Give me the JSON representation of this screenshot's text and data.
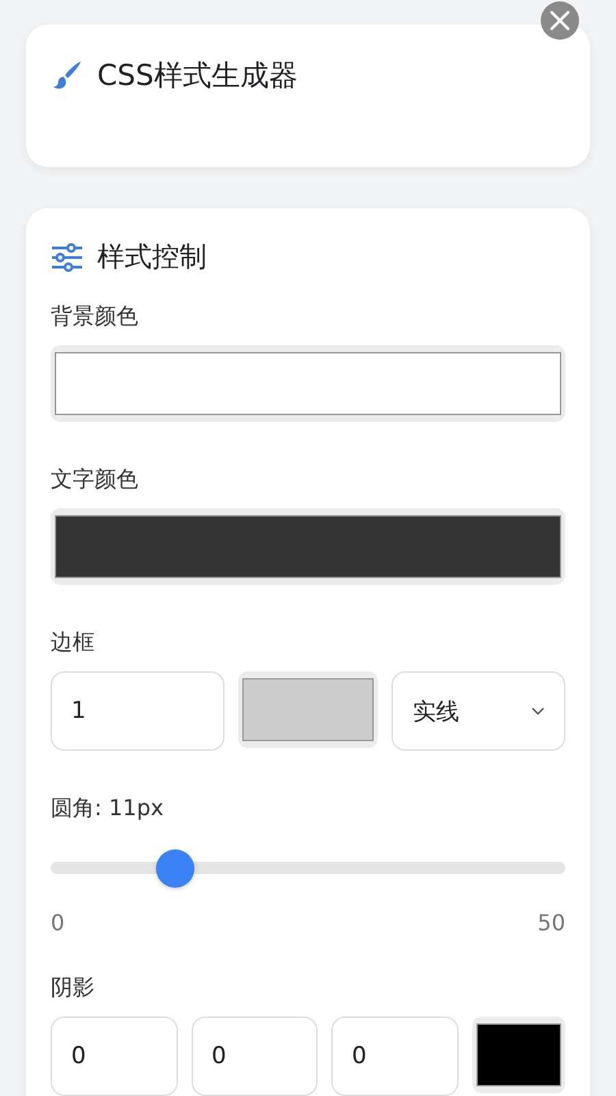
{
  "header": {
    "title": "CSS样式生成器"
  },
  "controls": {
    "title": "样式控制",
    "sections": [
      {
        "kind": "fields",
        "label": "背景颜色",
        "inputs": [
          {
            "kind": "color",
            "color": "#ffffff"
          }
        ]
      },
      {
        "kind": "fields",
        "label": "文字颜色",
        "inputs": [
          {
            "kind": "color",
            "color": "#333333"
          }
        ]
      },
      {
        "kind": "fields",
        "label": "边框",
        "inputs": [
          {
            "kind": "number",
            "value": "1"
          },
          {
            "kind": "color",
            "color": "#cccccc"
          },
          {
            "kind": "select",
            "value": "实线"
          }
        ]
      },
      {
        "kind": "slider",
        "label": "圆角: 11px",
        "level": 0.22,
        "min_label": "0",
        "max_label": "50"
      },
      {
        "kind": "fields",
        "label": "阴影",
        "inputs": [
          {
            "kind": "number",
            "value": "0"
          },
          {
            "kind": "number",
            "value": "0"
          },
          {
            "kind": "number",
            "value": "0"
          },
          {
            "kind": "color",
            "color": "#000000"
          }
        ]
      }
    ]
  }
}
